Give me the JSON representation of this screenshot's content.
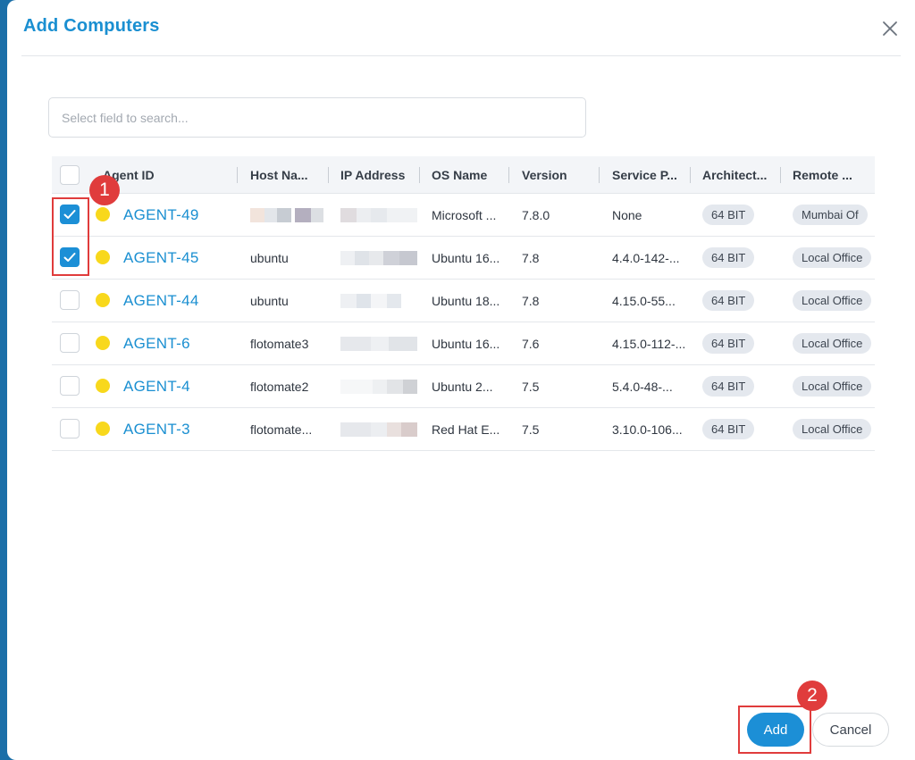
{
  "dialog": {
    "title": "Add Computers",
    "close_icon": "close-icon"
  },
  "search": {
    "placeholder": "Select field to search..."
  },
  "table": {
    "columns": [
      "Agent ID",
      "Host Na...",
      "IP Address",
      "OS Name",
      "Version",
      "Service P...",
      "Architect...",
      "Remote ..."
    ],
    "rows": [
      {
        "checked": true,
        "agent_id": "AGENT-49",
        "host": "",
        "os": "Microsoft ...",
        "version": "7.8.0",
        "service_pack": "None",
        "architecture": "64 BIT",
        "remote_office": "Mumbai Of"
      },
      {
        "checked": true,
        "agent_id": "AGENT-45",
        "host": "ubuntu",
        "os": "Ubuntu 16...",
        "version": "7.8",
        "service_pack": "4.4.0-142-...",
        "architecture": "64 BIT",
        "remote_office": "Local Office"
      },
      {
        "checked": false,
        "agent_id": "AGENT-44",
        "host": "ubuntu",
        "os": "Ubuntu 18...",
        "version": "7.8",
        "service_pack": "4.15.0-55...",
        "architecture": "64 BIT",
        "remote_office": "Local Office"
      },
      {
        "checked": false,
        "agent_id": "AGENT-6",
        "host": "flotomate3",
        "os": "Ubuntu 16...",
        "version": "7.6",
        "service_pack": "4.15.0-112-...",
        "architecture": "64 BIT",
        "remote_office": "Local Office"
      },
      {
        "checked": false,
        "agent_id": "AGENT-4",
        "host": "flotomate2",
        "os": "Ubuntu 2...",
        "version": "7.5",
        "service_pack": "5.4.0-48-...",
        "architecture": "64 BIT",
        "remote_office": "Local Office"
      },
      {
        "checked": false,
        "agent_id": "AGENT-3",
        "host": "flotomate...",
        "os": "Red Hat E...",
        "version": "7.5",
        "service_pack": "3.10.0-106...",
        "architecture": "64 BIT",
        "remote_office": "Local Office"
      }
    ]
  },
  "annotations": {
    "step1": "1",
    "step2": "2"
  },
  "footer": {
    "add_label": "Add",
    "cancel_label": "Cancel"
  },
  "colors": {
    "accent": "#1a8fd1",
    "status_dot": "#f8d81c",
    "annotation": "#e03c3c"
  }
}
